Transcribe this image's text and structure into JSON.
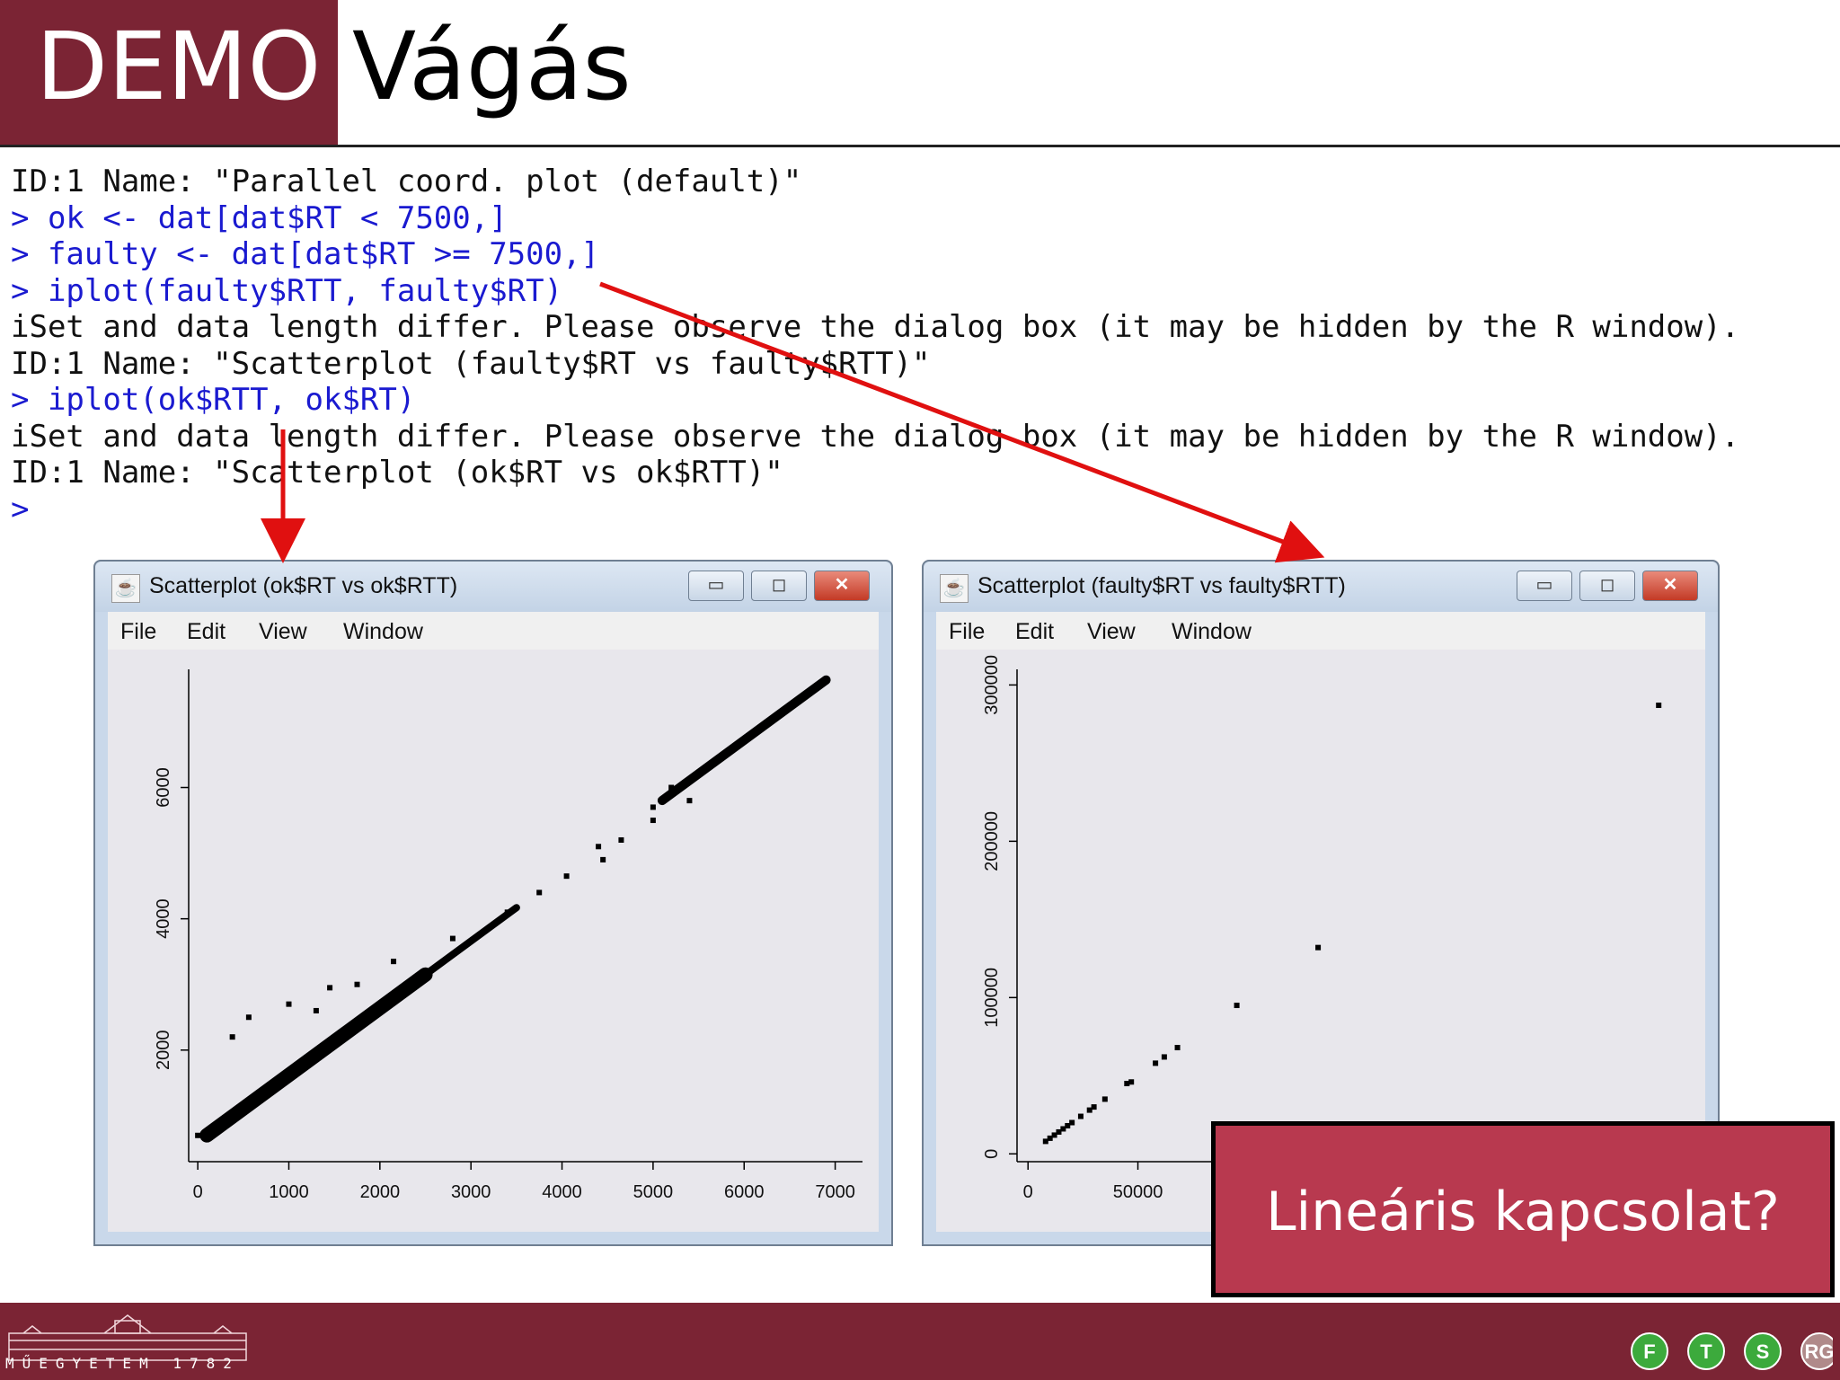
{
  "slide": {
    "demo_label": "DEMO",
    "title": "Vágás"
  },
  "console": [
    {
      "type": "out",
      "text": "ID:1 Name: \"Parallel coord. plot (default)\""
    },
    {
      "type": "cmd",
      "text": "> ok <- dat[dat$RT < 7500,]"
    },
    {
      "type": "cmd",
      "text": "> faulty <- dat[dat$RT >= 7500,]"
    },
    {
      "type": "cmd",
      "text": "> iplot(faulty$RTT, faulty$RT)"
    },
    {
      "type": "out",
      "text": "iSet and data length differ. Please observe the dialog box (it may be hidden by the R window)."
    },
    {
      "type": "out",
      "text": "ID:1 Name: \"Scatterplot (faulty$RT vs faulty$RTT)\""
    },
    {
      "type": "cmd",
      "text": "> iplot(ok$RTT, ok$RT)"
    },
    {
      "type": "out",
      "text": "iSet and data length differ. Please observe the dialog box (it may be hidden by the R window)."
    },
    {
      "type": "out",
      "text": "ID:1 Name: \"Scatterplot (ok$RT vs ok$RTT)\""
    },
    {
      "type": "cmd",
      "text": ">"
    }
  ],
  "window_left": {
    "title": "Scatterplot (ok$RT vs ok$RTT)",
    "menu": [
      "File",
      "Edit",
      "View",
      "Window"
    ]
  },
  "window_right": {
    "title": "Scatterplot (faulty$RT vs faulty$RTT)",
    "menu": [
      "File",
      "Edit",
      "View",
      "Window"
    ]
  },
  "window_buttons": {
    "minimize": "▭",
    "maximize": "◻",
    "close": "✕"
  },
  "callout": {
    "text": "Lineáris kapcsolat?"
  },
  "footer": {
    "logo_text": "MŰEGYETEM 1782",
    "group_letters": [
      "F",
      "T",
      "S",
      "RG"
    ]
  },
  "colors": {
    "brand": "#7b2434",
    "callout": "#b8394f",
    "command": "#1a1ad0",
    "arrow": "#e01010"
  },
  "chart_data": [
    {
      "type": "scatter",
      "title": "Scatterplot (ok$RT vs ok$RTT)",
      "xlabel": "",
      "ylabel": "",
      "xlim": [
        -100,
        7300
      ],
      "ylim": [
        300,
        7800
      ],
      "xticks": [
        0,
        1000,
        2000,
        3000,
        4000,
        5000,
        6000,
        7000
      ],
      "yticks": [
        2000,
        4000,
        6000
      ],
      "band": [
        {
          "x0": 100,
          "x1": 2500,
          "y_base": 0.95,
          "slope": 1.02,
          "width": 220
        },
        {
          "x0": 2500,
          "x1": 3500,
          "y_base": 0.95,
          "slope": 1.02,
          "width": 110
        },
        {
          "x0": 5100,
          "x1": 6900,
          "y_base": 0.95,
          "slope": 1.02,
          "width": 140
        }
      ],
      "points": [
        [
          0,
          700
        ],
        [
          380,
          2200
        ],
        [
          560,
          2500
        ],
        [
          1000,
          2700
        ],
        [
          1300,
          2600
        ],
        [
          1450,
          2950
        ],
        [
          1750,
          3000
        ],
        [
          2150,
          3350
        ],
        [
          2800,
          3700
        ],
        [
          3400,
          4100
        ],
        [
          3750,
          4400
        ],
        [
          4050,
          4650
        ],
        [
          4400,
          5100
        ],
        [
          4450,
          4900
        ],
        [
          4650,
          5200
        ],
        [
          5000,
          5500
        ],
        [
          5000,
          5700
        ],
        [
          5400,
          5800
        ],
        [
          5200,
          6000
        ]
      ]
    },
    {
      "type": "scatter",
      "title": "Scatterplot (faulty$RT vs faulty$RTT)",
      "xlabel": "",
      "ylabel": "",
      "xlim": [
        -5000,
        300000
      ],
      "ylim": [
        -5000,
        310000
      ],
      "xticks": [
        0,
        50000
      ],
      "yticks": [
        0,
        100000,
        200000,
        300000
      ],
      "points": [
        [
          8000,
          8000
        ],
        [
          10000,
          10000
        ],
        [
          12000,
          12000
        ],
        [
          14000,
          14000
        ],
        [
          16000,
          16000
        ],
        [
          18000,
          18000
        ],
        [
          20000,
          20000
        ],
        [
          24000,
          24000
        ],
        [
          28000,
          28000
        ],
        [
          30000,
          30000
        ],
        [
          35000,
          35000
        ],
        [
          45000,
          45000
        ],
        [
          47000,
          46000
        ],
        [
          58000,
          58000
        ],
        [
          62000,
          62000
        ],
        [
          68000,
          68000
        ],
        [
          95000,
          95000
        ],
        [
          132000,
          132000
        ],
        [
          287000,
          287000
        ]
      ]
    }
  ]
}
